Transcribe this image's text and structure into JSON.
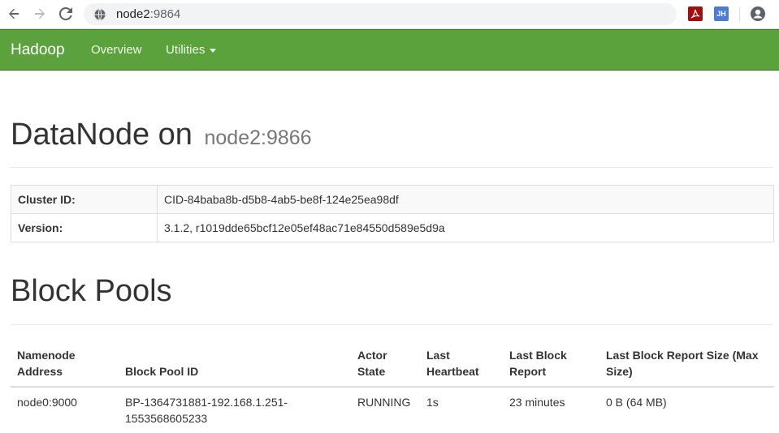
{
  "browser": {
    "url_host": "node2",
    "url_port": ":9864",
    "back_icon": "arrow-left-icon",
    "forward_icon": "arrow-right-icon",
    "reload_icon": "reload-icon",
    "site_icon": "globe-icon",
    "ext_pdf_label": "",
    "ext_jh_label": "JH",
    "profile_icon": "account-circle-icon"
  },
  "navbar": {
    "brand": "Hadoop",
    "links": [
      "Overview",
      "Utilities"
    ],
    "bg_color": "#5ba23d"
  },
  "page": {
    "title": "DataNode on",
    "title_small": "node2:9866",
    "info": [
      {
        "key": "Cluster ID:",
        "value": "CID-84baba8b-d5b8-4ab5-be8f-124e25ea98df"
      },
      {
        "key": "Version:",
        "value": "3.1.2, r1019dde65bcf12e05ef48ac71e84550d589e5d9a"
      }
    ],
    "block_pools_heading": "Block Pools",
    "pools_table": {
      "headers": [
        "Namenode Address",
        "Block Pool ID",
        "Actor State",
        "Last Heartbeat",
        "Last Block Report",
        "Last Block Report Size (Max Size)"
      ],
      "rows": [
        [
          "node0:9000",
          "BP-1364731881-192.168.1.251-1553568605233",
          "RUNNING",
          "1s",
          "23 minutes",
          "0 B (64 MB)"
        ]
      ]
    }
  }
}
